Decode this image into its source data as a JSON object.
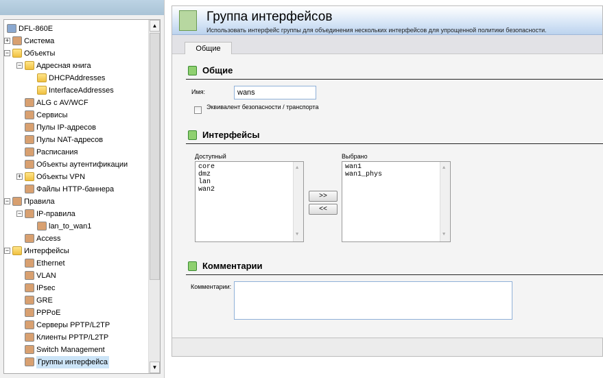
{
  "tree": [
    {
      "label": "DFL-860E",
      "level": 0
    },
    {
      "label": "Система",
      "level": 1,
      "exp": "+"
    },
    {
      "label": "Объекты",
      "level": 1,
      "exp": "-",
      "folder": true
    },
    {
      "label": "Адресная книга",
      "level": 2,
      "exp": "-",
      "folder": true
    },
    {
      "label": "DHCPAddresses",
      "level": 3,
      "folder": true
    },
    {
      "label": "InterfaceAddresses",
      "level": 3,
      "folder": true
    },
    {
      "label": "ALG с AV/WCF",
      "level": 2
    },
    {
      "label": "Сервисы",
      "level": 2
    },
    {
      "label": "Пулы IP-адресов",
      "level": 2
    },
    {
      "label": "Пулы NAT-адресов",
      "level": 2
    },
    {
      "label": "Расписания",
      "level": 2
    },
    {
      "label": "Объекты аутентификации",
      "level": 2
    },
    {
      "label": "Объекты VPN",
      "level": 2,
      "exp": "+",
      "folder": true
    },
    {
      "label": "Файлы HTTP-баннера",
      "level": 2
    },
    {
      "label": "Правила",
      "level": 1,
      "exp": "-"
    },
    {
      "label": "IP-правила",
      "level": 2,
      "exp": "-"
    },
    {
      "label": "lan_to_wan1",
      "level": 3
    },
    {
      "label": "Access",
      "level": 2
    },
    {
      "label": "Интерфейсы",
      "level": 1,
      "exp": "-",
      "folder": true
    },
    {
      "label": "Ethernet",
      "level": 2
    },
    {
      "label": "VLAN",
      "level": 2
    },
    {
      "label": "IPsec",
      "level": 2
    },
    {
      "label": "GRE",
      "level": 2
    },
    {
      "label": "PPPoE",
      "level": 2
    },
    {
      "label": "Серверы PPTP/L2TP",
      "level": 2
    },
    {
      "label": "Клиенты PPTP/L2TP",
      "level": 2
    },
    {
      "label": "Switch Management",
      "level": 2
    },
    {
      "label": "Группы интерфейса",
      "level": 2,
      "selected": true
    }
  ],
  "header": {
    "title": "Группа интерфейсов",
    "subtitle": "Использовать интерфейс группы для объединения нескольких интерфейсов для упрощенной политики безопасности."
  },
  "tab": "Общие",
  "general": {
    "title": "Общие",
    "name_label": "Имя:",
    "name_value": "wans",
    "checkbox_label": "Эквивалент безопасности / транспорта"
  },
  "interfaces": {
    "title": "Интерфейсы",
    "available_label": "Доступный",
    "selected_label": "Выбрано",
    "available": [
      "core",
      "dmz",
      "lan",
      "wan2"
    ],
    "selected": [
      "wan1",
      "wan1_phys"
    ],
    "add": ">>",
    "remove": "<<"
  },
  "comments": {
    "title": "Комментарии",
    "label": "Комментарии:",
    "value": ""
  }
}
